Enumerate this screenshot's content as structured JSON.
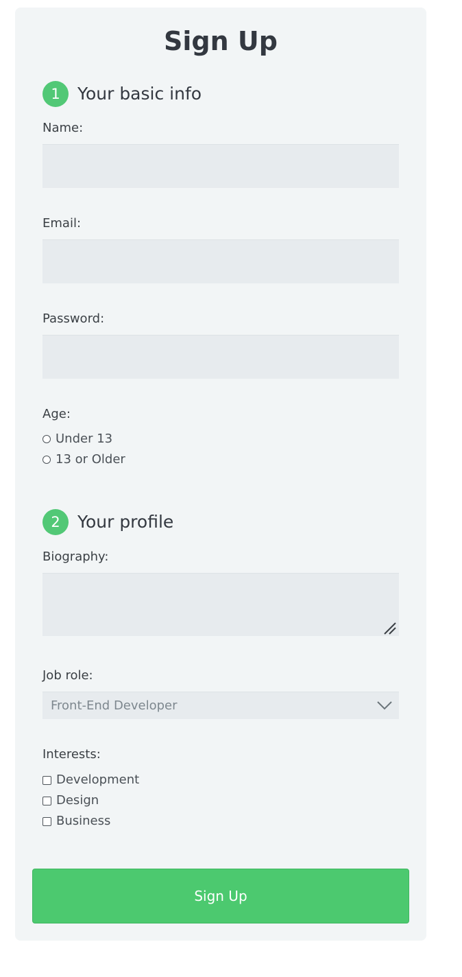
{
  "colors": {
    "accent": "#52c876",
    "button": "#4cc96f",
    "card_background": "#f2f5f6",
    "input_background": "#e7ebee"
  },
  "form": {
    "title": "Sign Up",
    "sections": [
      {
        "number": "1",
        "title": "Your basic info"
      },
      {
        "number": "2",
        "title": "Your profile"
      }
    ],
    "fields": {
      "name": {
        "label": "Name:",
        "value": ""
      },
      "email": {
        "label": "Email:",
        "value": ""
      },
      "password": {
        "label": "Password:",
        "value": ""
      },
      "age": {
        "label": "Age:",
        "options": [
          {
            "label": "Under 13",
            "selected": false
          },
          {
            "label": "13 or Older",
            "selected": false
          }
        ]
      },
      "biography": {
        "label": "Biography:",
        "value": ""
      },
      "job_role": {
        "label": "Job role:",
        "selected": "Front-End Developer"
      },
      "interests": {
        "label": "Interests:",
        "options": [
          {
            "label": "Development",
            "checked": false
          },
          {
            "label": "Design",
            "checked": false
          },
          {
            "label": "Business",
            "checked": false
          }
        ]
      }
    },
    "submit_label": "Sign Up"
  },
  "icons": {
    "resize": "resize-handle-icon",
    "dropdown": "chevron-down-icon"
  }
}
